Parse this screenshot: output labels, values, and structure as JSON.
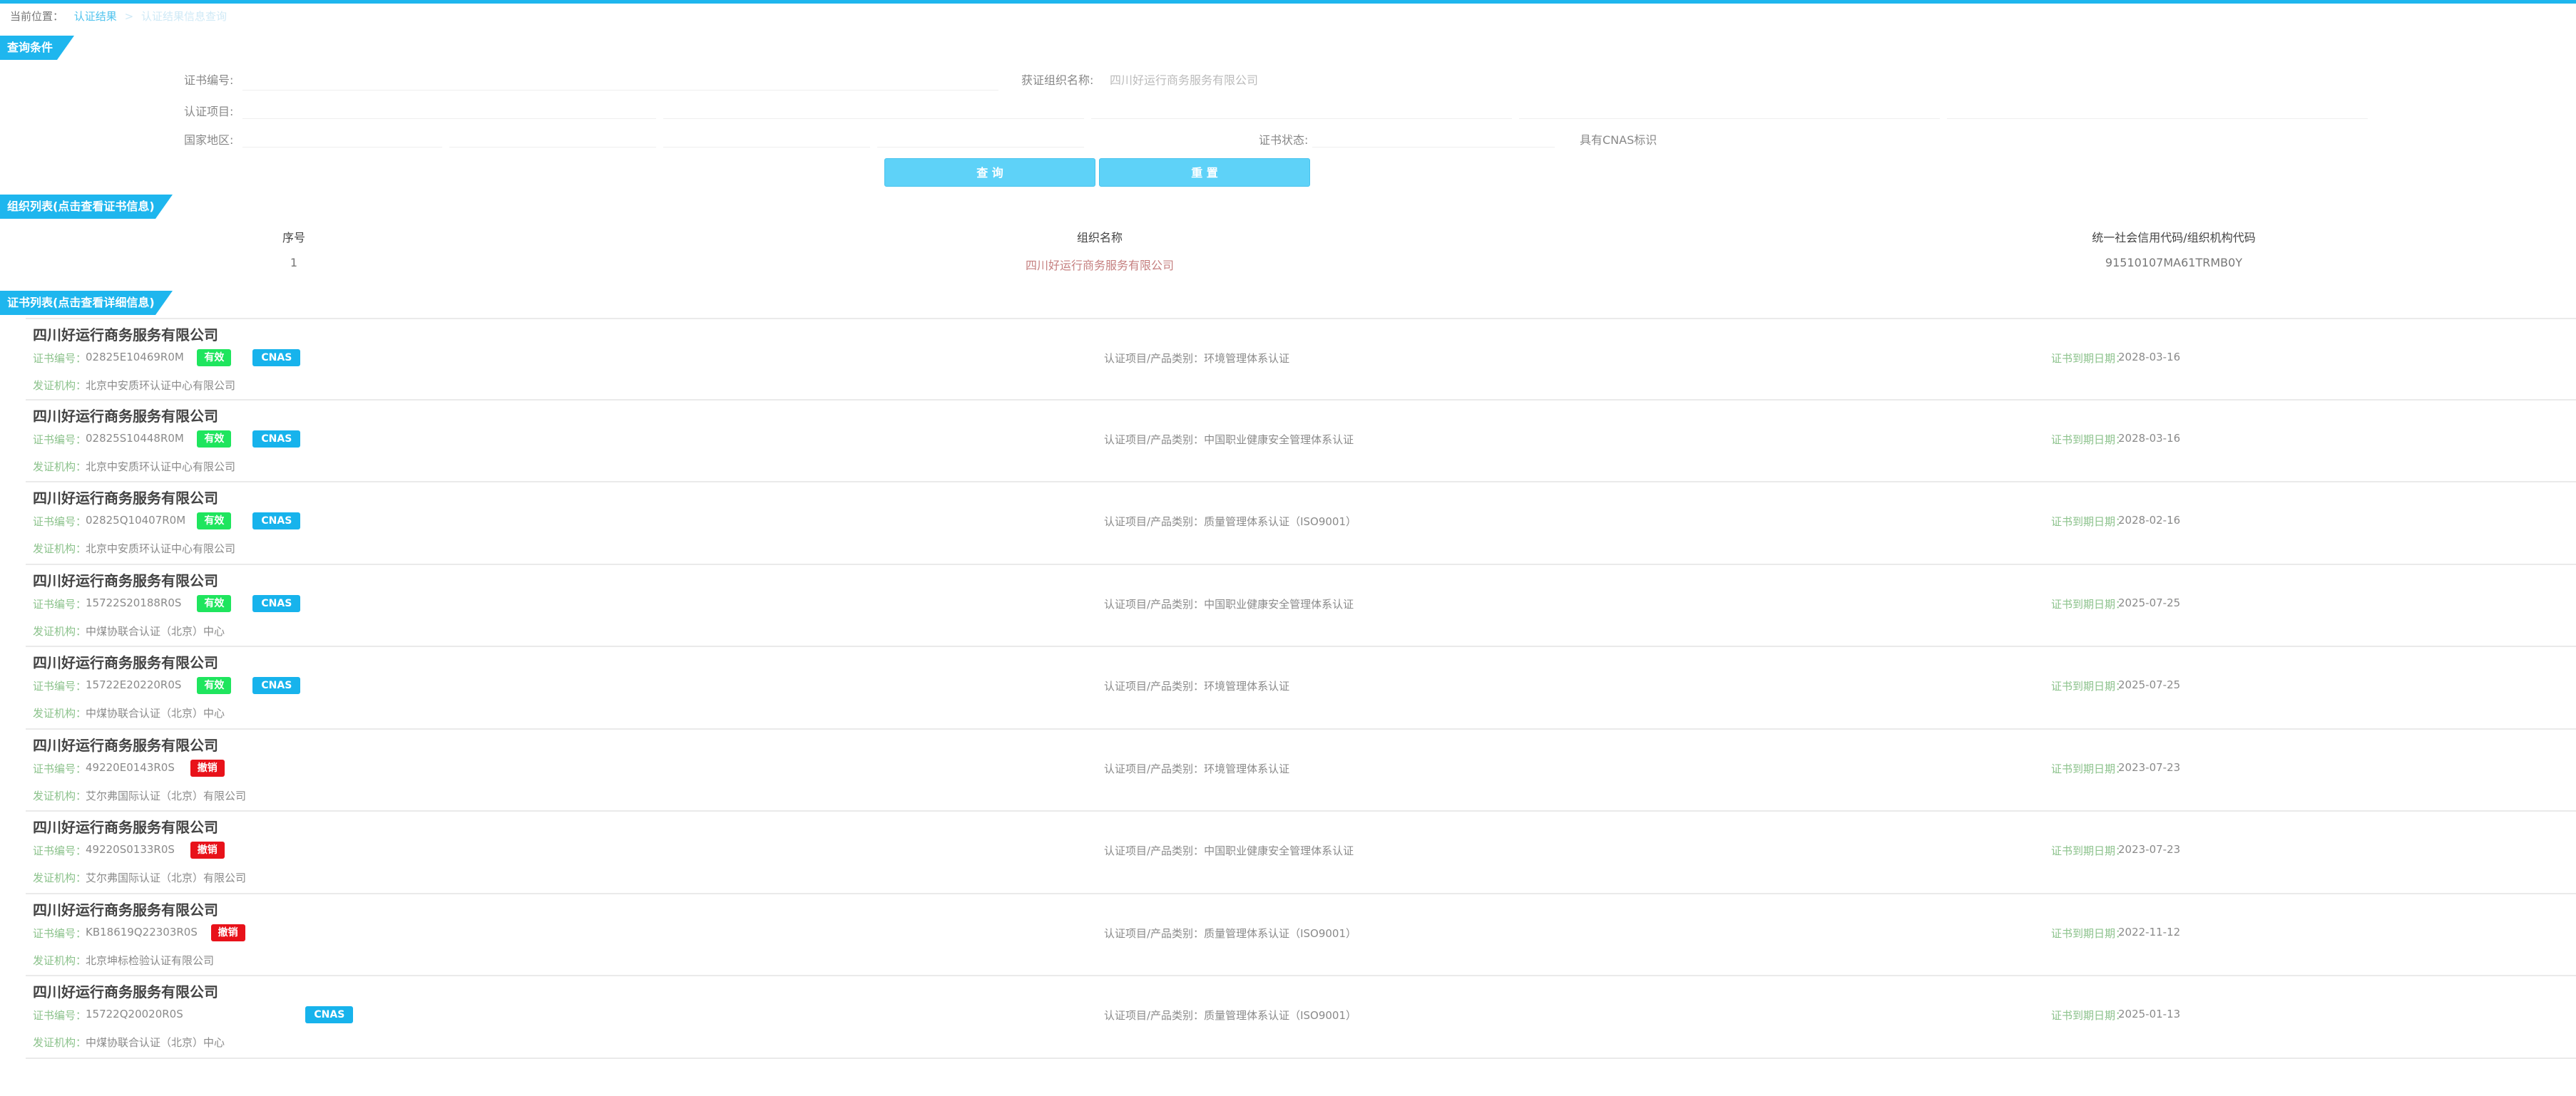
{
  "breadcrumb": {
    "label": "当前位置：",
    "link": "认证结果",
    "separator": ">",
    "current": "认证结果信息查询"
  },
  "sections": {
    "query": "查询条件",
    "org_list": "组织列表(点击查看证书信息)",
    "cert_list": "证书列表(点击查看详细信息)"
  },
  "query_form": {
    "cert_no_label": "证书编号:",
    "org_name_label": "获证组织名称:",
    "org_name_value": "四川好运行商务服务有限公司",
    "project_label": "认证项目:",
    "country_label": "国家地区:",
    "status_label": "证书状态:",
    "cnas_label": "具有CNAS标识"
  },
  "buttons": {
    "query": "查 询",
    "reset": "重 置"
  },
  "org_table": {
    "headers": [
      "序号",
      "组织名称",
      "统一社会信用代码/组织机构代码"
    ],
    "rows": [
      {
        "seq": "1",
        "name": "四川好运行商务服务有限公司",
        "code": "91510107MA61TRMB0Y"
      }
    ]
  },
  "cert_labels": {
    "cert_no": "证书编号：",
    "project": "认证项目/产品类别：",
    "expire": "证书到期日期：",
    "issuer": "发证机构："
  },
  "colors": {
    "accent": "#1eb6ee",
    "valid": "#1fe55e",
    "revoked": "#e8121a",
    "cnas": "#17b3ec"
  },
  "certs": [
    {
      "org": "四川好运行商务服务有限公司",
      "cert_no": "02825E10469R0M",
      "status": "有效",
      "cnas": "CNAS",
      "project": "环境管理体系认证",
      "expire": "2028-03-16",
      "issuer": "北京中安质环认证中心有限公司"
    },
    {
      "org": "四川好运行商务服务有限公司",
      "cert_no": "02825S10448R0M",
      "status": "有效",
      "cnas": "CNAS",
      "project": "中国职业健康安全管理体系认证",
      "expire": "2028-03-16",
      "issuer": "北京中安质环认证中心有限公司"
    },
    {
      "org": "四川好运行商务服务有限公司",
      "cert_no": "02825Q10407R0M",
      "status": "有效",
      "cnas": "CNAS",
      "project": "质量管理体系认证（ISO9001）",
      "expire": "2028-02-16",
      "issuer": "北京中安质环认证中心有限公司"
    },
    {
      "org": "四川好运行商务服务有限公司",
      "cert_no": "15722S20188R0S",
      "status": "有效",
      "cnas": "CNAS",
      "project": "中国职业健康安全管理体系认证",
      "expire": "2025-07-25",
      "issuer": "中煤协联合认证（北京）中心"
    },
    {
      "org": "四川好运行商务服务有限公司",
      "cert_no": "15722E20220R0S",
      "status": "有效",
      "cnas": "CNAS",
      "project": "环境管理体系认证",
      "expire": "2025-07-25",
      "issuer": "中煤协联合认证（北京）中心"
    },
    {
      "org": "四川好运行商务服务有限公司",
      "cert_no": "49220E0143R0S",
      "status": "撤销",
      "cnas": "",
      "project": "环境管理体系认证",
      "expire": "2023-07-23",
      "issuer": "艾尔弗国际认证（北京）有限公司"
    },
    {
      "org": "四川好运行商务服务有限公司",
      "cert_no": "49220S0133R0S",
      "status": "撤销",
      "cnas": "",
      "project": "中国职业健康安全管理体系认证",
      "expire": "2023-07-23",
      "issuer": "艾尔弗国际认证（北京）有限公司"
    },
    {
      "org": "四川好运行商务服务有限公司",
      "cert_no": "KB18619Q22303R0S",
      "status": "撤销",
      "cnas": "",
      "project": "质量管理体系认证（ISO9001）",
      "expire": "2022-11-12",
      "issuer": "北京坤标检验认证有限公司"
    },
    {
      "org": "四川好运行商务服务有限公司",
      "cert_no": "15722Q20020R0S",
      "status": "",
      "cnas": "CNAS",
      "project": "质量管理体系认证（ISO9001）",
      "expire": "2025-01-13",
      "issuer": "中煤协联合认证（北京）中心"
    }
  ]
}
